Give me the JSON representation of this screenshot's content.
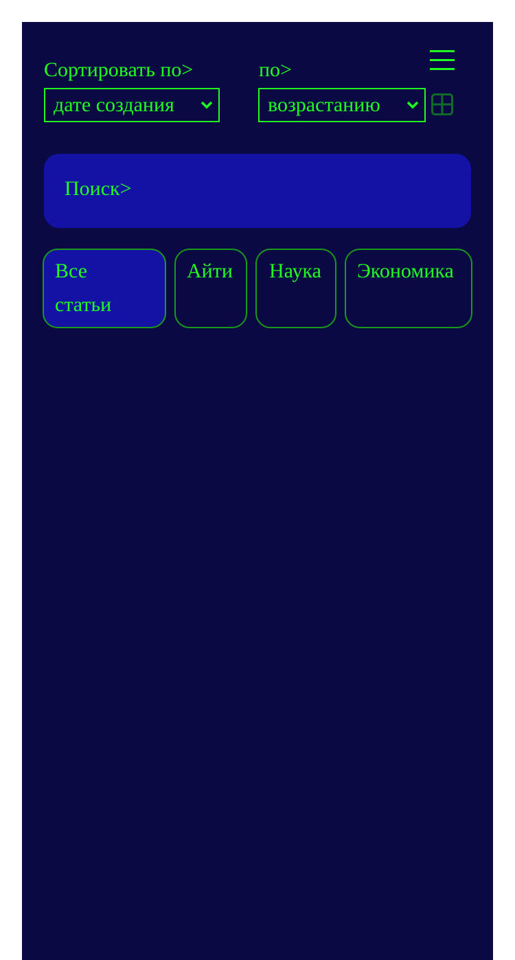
{
  "sort": {
    "label": "Сортировать по>",
    "selected": "дате создания"
  },
  "order": {
    "label": "по>",
    "selected": "возрастанию"
  },
  "search": {
    "placeholder": "Поиск>"
  },
  "tabs": [
    {
      "label": "Все статьи",
      "active": true
    },
    {
      "label": "Айти",
      "active": false
    },
    {
      "label": "Наука",
      "active": false
    },
    {
      "label": "Экономика",
      "active": false
    }
  ],
  "icons": {
    "menu": "hamburger-menu-icon",
    "grid": "grid-view-icon",
    "chevron": "chevron-down-icon"
  },
  "colors": {
    "background": "#0a0944",
    "accent_text": "#20ff20",
    "panel": "#1312a4",
    "tab_border": "#1a9a1a"
  }
}
